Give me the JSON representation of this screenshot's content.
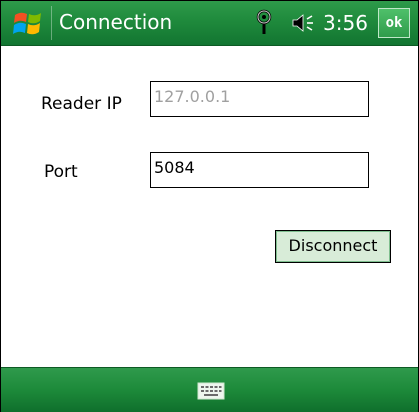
{
  "titlebar": {
    "title": "Connection",
    "clock": "3:56",
    "ok_label": "ok",
    "icons": [
      "windows-start-icon",
      "antenna-icon",
      "volume-icon"
    ]
  },
  "form": {
    "reader_ip_label": "Reader IP",
    "reader_ip_value": "127.0.0.1",
    "port_label": "Port",
    "port_value": "5084",
    "disconnect_label": "Disconnect"
  },
  "bottombar": {
    "icons": [
      "keyboard-icon"
    ]
  },
  "colors": {
    "bar_green": "#1f8a3c",
    "button_fill": "#d8ecd8",
    "disabled_text": "#a0a0a0"
  }
}
